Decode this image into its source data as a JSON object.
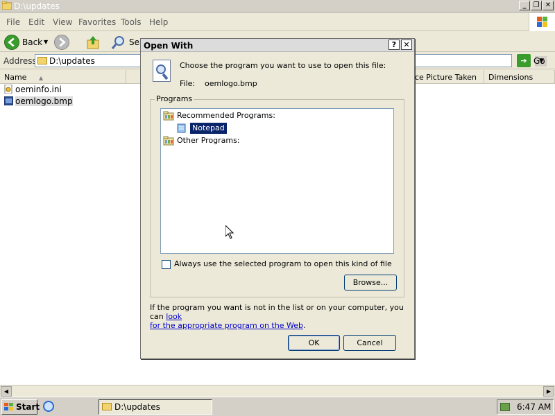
{
  "explorer": {
    "title": "D:\\updates",
    "menu": [
      "File",
      "Edit",
      "View",
      "Favorites",
      "Tools",
      "Help"
    ],
    "toolbar": {
      "back_label": "Back",
      "search_label": "Sea"
    },
    "address": {
      "label": "Address",
      "value": "D:\\updates",
      "go_label": "Go"
    },
    "columns": [
      "Name",
      "ce Picture Taken",
      "Dimensions"
    ],
    "files": [
      {
        "name": "oeminfo.ini",
        "icon": "ini-file-icon"
      },
      {
        "name": "oemlogo.bmp",
        "icon": "bmp-file-icon"
      }
    ]
  },
  "dialog": {
    "title": "Open With",
    "help_btn": "?",
    "close_btn": "✕",
    "instruction": "Choose the program you want to use to open this file:",
    "file_label": "File:",
    "file_name": "oemlogo.bmp",
    "programs_group": "Programs",
    "recommended_label": "Recommended Programs:",
    "recommended_items": [
      "Notepad"
    ],
    "other_label": "Other Programs:",
    "always_use_label": "Always use the selected program to open this kind of file",
    "always_use_checked": false,
    "browse_label": "Browse...",
    "info_text": "If the program you want is not in the list or on your computer, you can ",
    "info_link_1": "look",
    "info_link_2": "for the appropriate program on the Web",
    "info_period": ".",
    "ok_label": "OK",
    "cancel_label": "Cancel"
  },
  "taskbar": {
    "start_label": "Start",
    "task_label": "D:\\updates",
    "clock": "6:47 AM"
  },
  "colors": {
    "selection": "#0a246a",
    "link": "#0000cc",
    "dialog_bg": "#ece9d8"
  }
}
